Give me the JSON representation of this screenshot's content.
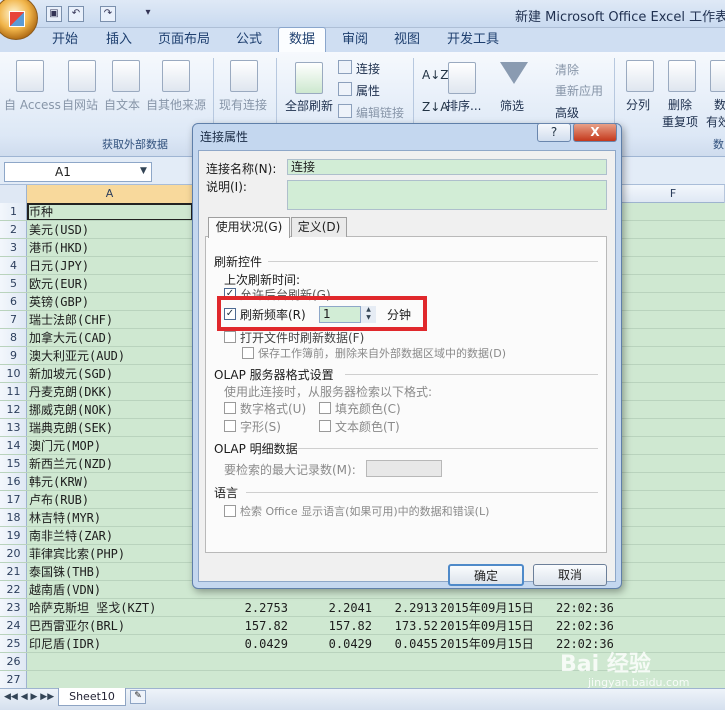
{
  "window": {
    "title": "新建 Microsoft Office Excel 工作表.xl"
  },
  "tabs": [
    "开始",
    "插入",
    "页面布局",
    "公式",
    "数据",
    "审阅",
    "视图",
    "开发工具"
  ],
  "ribbon": {
    "get_external": {
      "access": "自 Access",
      "web": "自网站",
      "text": "自文本",
      "other": "自其他来源",
      "existing": "现有连接",
      "group": "获取外部数据"
    },
    "connections": {
      "refresh_all": "全部刷新",
      "connections": "连接",
      "properties": "属性",
      "edit_links": "编辑链接",
      "group": "连接"
    },
    "sort": {
      "sort": "排序...",
      "group": "排序和筛选"
    },
    "filter": {
      "filter": "筛选",
      "clear": "清除",
      "reapply": "重新应用",
      "advanced": "高级"
    },
    "tools": {
      "split": "分列",
      "remove_dup_1": "删除",
      "remove_dup_2": "重复项",
      "validity_1": "数",
      "validity_2": "有效",
      "group": "数"
    }
  },
  "namebox": "A1",
  "columns": [
    "A",
    "F"
  ],
  "rows": [
    {
      "n": "1",
      "a": "币种"
    },
    {
      "n": "2",
      "a": "美元(USD)"
    },
    {
      "n": "3",
      "a": "港币(HKD)"
    },
    {
      "n": "4",
      "a": "日元(JPY)"
    },
    {
      "n": "5",
      "a": "欧元(EUR)"
    },
    {
      "n": "6",
      "a": "英镑(GBP)"
    },
    {
      "n": "7",
      "a": "瑞士法郎(CHF)"
    },
    {
      "n": "8",
      "a": "加拿大元(CAD)"
    },
    {
      "n": "9",
      "a": "澳大利亚元(AUD)"
    },
    {
      "n": "10",
      "a": "新加坡元(SGD)"
    },
    {
      "n": "11",
      "a": "丹麦克朗(DKK)"
    },
    {
      "n": "12",
      "a": "挪威克朗(NOK)"
    },
    {
      "n": "13",
      "a": "瑞典克朗(SEK)"
    },
    {
      "n": "14",
      "a": "澳门元(MOP)"
    },
    {
      "n": "15",
      "a": "新西兰元(NZD)"
    },
    {
      "n": "16",
      "a": "韩元(KRW)"
    },
    {
      "n": "17",
      "a": "卢布(RUB)"
    },
    {
      "n": "18",
      "a": "林吉特(MYR)"
    },
    {
      "n": "19",
      "a": "南非兰特(ZAR)"
    },
    {
      "n": "20",
      "a": "菲律宾比索(PHP)"
    },
    {
      "n": "21",
      "a": "泰国铢(THB)"
    },
    {
      "n": "22",
      "a": "越南盾(VDN)"
    },
    {
      "n": "23",
      "a": "哈萨克斯坦 坚戈(KZT)",
      "b": "2.2753",
      "c": "2.2041",
      "d": "2.2913",
      "e": "2015年09月15日",
      "f": "22:02:36"
    },
    {
      "n": "24",
      "a": "巴西雷亚尔(BRL)",
      "b": "157.82",
      "c": "157.82",
      "d": "173.52",
      "e": "2015年09月15日",
      "f": "22:02:36"
    },
    {
      "n": "25",
      "a": "印尼盾(IDR)",
      "b": "0.0429",
      "c": "0.0429",
      "d": "0.0455",
      "e": "2015年09月15日",
      "f": "22:02:36"
    },
    {
      "n": "26",
      "a": ""
    },
    {
      "n": "27",
      "a": ""
    }
  ],
  "sheet_tab": "Sheet10",
  "dialog": {
    "title": "连接属性",
    "help": "?",
    "close": "X",
    "name_label": "连接名称(N):",
    "name_value": "连接",
    "desc_label": "说明(I):",
    "tab_usage": "使用状况(G)",
    "tab_definition": "定义(D)",
    "refresh_control": "刷新控件",
    "last_refresh": "上次刷新时间:",
    "background_refresh": "允许后台刷新(G)",
    "refresh_every": "刷新频率(R)",
    "refresh_value": "1",
    "minutes": "分钟",
    "refresh_on_open": "打开文件时刷新数据(F)",
    "remove_data": "保存工作簿前，删除来自外部数据区域中的数据(D)",
    "olap_format": "OLAP 服务器格式设置",
    "olap_retrieve": "使用此连接时，从服务器检索以下格式:",
    "number_format": "数字格式(U)",
    "fill_color": "填充颜色(C)",
    "font_style": "字形(S)",
    "text_color": "文本颜色(T)",
    "olap_drill": "OLAP 明细数据",
    "max_records": "要检索的最大记录数(M):",
    "language": "语言",
    "language_option": "检索 Office 显示语言(如果可用)中的数据和错误(L)",
    "ok": "确定",
    "cancel": "取消"
  },
  "watermark": {
    "brand": "Bai 经验",
    "url": "jingyan.baidu.com"
  },
  "colors": {
    "cell_fill": "#cfe8d1",
    "highlight": "#e0282c",
    "ribbon": "#dde8f6"
  }
}
